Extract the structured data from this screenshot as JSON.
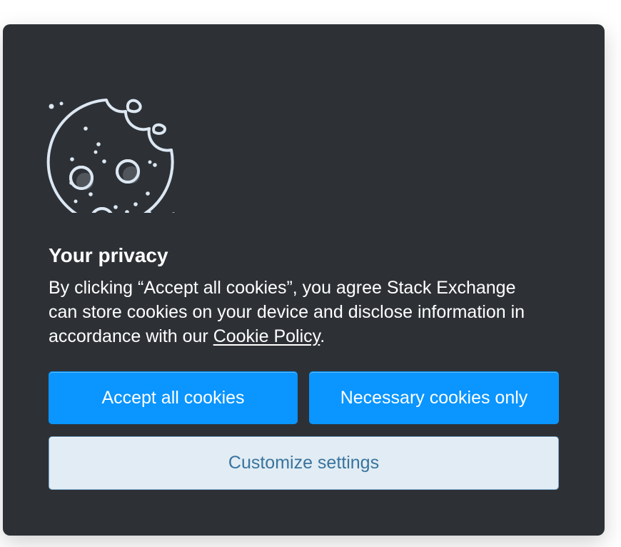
{
  "dialog": {
    "icon": "cookie-icon",
    "title": "Your privacy",
    "body_before_link": "By clicking “Accept all cookies”, you agree Stack Exchange can store cookies on your device and disclose information in accordance with our ",
    "link_text": "Cookie Policy",
    "body_after_link": ".",
    "buttons": {
      "accept_all": "Accept all cookies",
      "necessary_only": "Necessary cookies only",
      "customize": "Customize settings"
    }
  },
  "colors": {
    "dialog_background": "#2d3136",
    "primary_button": "#0a95ff",
    "secondary_button": "#e1ecf4",
    "secondary_button_text": "#39739d",
    "icon_stroke": "#dce7f2"
  }
}
